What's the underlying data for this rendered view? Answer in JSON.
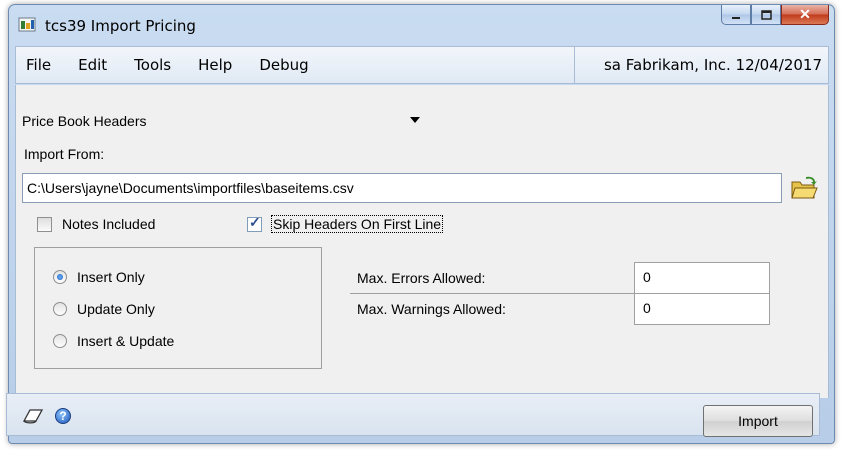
{
  "window": {
    "title": "tcs39 Import Pricing",
    "minimize_icon": "minimize-icon",
    "maximize_icon": "maximize-icon",
    "close_icon": "close-icon"
  },
  "menu": {
    "items": [
      "File",
      "Edit",
      "Tools",
      "Help",
      "Debug"
    ],
    "status": "sa  Fabrikam, Inc.  12/04/2017"
  },
  "form": {
    "import_type": "Price Book Headers",
    "import_from_label": "Import From:",
    "import_from_value": "C:\\Users\\jayne\\Documents\\importfiles\\baseitems.csv",
    "notes_included_label": "Notes Included",
    "notes_included_checked": false,
    "skip_headers_label": "Skip Headers On First Line",
    "skip_headers_checked": true,
    "radio_options": [
      {
        "label": "Insert Only",
        "selected": true
      },
      {
        "label": "Update Only",
        "selected": false
      },
      {
        "label": "Insert & Update",
        "selected": false
      }
    ],
    "max_errors_label": "Max. Errors Allowed:",
    "max_errors_value": "0",
    "max_warnings_label": "Max.  Warnings Allowed:",
    "max_warnings_value": "0"
  },
  "footer": {
    "note_icon": "note-icon",
    "help_icon": "help-icon",
    "import_button_label": "Import"
  },
  "colors": {
    "titlebar": "#c9dcf1",
    "content_bg": "#f0f0f0",
    "close_button": "#c0391b"
  }
}
